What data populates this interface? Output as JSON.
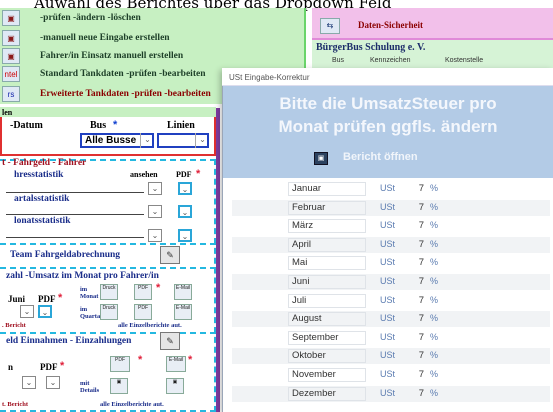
{
  "top_title": "Auwahl des Berichtes über das Dropdown Feld",
  "menu": {
    "items": [
      {
        "label": "-prüfen -ändern -löschen",
        "icon": "report-icon"
      },
      {
        "label": "-manuell neue Eingabe erstellen",
        "icon": "report-icon"
      },
      {
        "label": "Fahrer/in Einsatz manuell erstellen",
        "icon": "report-icon"
      },
      {
        "label": "Standard Tankdaten -prüfen -bearbeiten",
        "icon": "report-icon"
      },
      {
        "label": "Erweiterte Tankdaten -prüfen -bearbeiten",
        "icon": "report-icon"
      }
    ],
    "small_labels": [
      "ntel",
      "rs"
    ]
  },
  "header_right": {
    "security_label": "Daten-Sicherheit",
    "org_title": "BürgerBus Schulung e. V.",
    "columns": [
      "Bus",
      "Kennzeichen",
      "Kostenstelle"
    ]
  },
  "form": {
    "section_label": "len",
    "datum_label": "-Datum",
    "bus_label": "Bus",
    "star": "*",
    "linien_label": "Linien",
    "bus_value": "Alle Busse"
  },
  "stats": {
    "title": "t - Fahrgeld - Fahrer",
    "view_label": "ansehen",
    "pdf_label": "PDF",
    "rows": [
      "hresstatistik",
      "artalsstatistik",
      "lonatsstatistik"
    ],
    "team_label": "Team Fahrgeldabrechnung",
    "sum_title": "zahl -Umsatz im Monat pro Fahrer/in",
    "juni_label": "Juni",
    "im_monat": "im Monat",
    "im_quartal": "im Quartal",
    "druck": "Druck",
    "email": "E-Mail",
    "bericht": ". Bericht",
    "alle_einzel": "alle Einzelberichte aut.",
    "cash_title": "eld Einnahmen - Einzahlungen",
    "n_label": "n",
    "mit_details": "mit Details",
    "bericht2": "t. Bericht",
    "alle_einzel2": "alle Einzelberichte aut."
  },
  "dialog": {
    "window_title": "USt Eingabe-Korrektur",
    "heading_line1": "Bitte die UmsatzSteuer pro",
    "heading_line2": "Monat prüfen ggfls. ändern",
    "report_button": "Bericht öffnen",
    "ust_label": "USt",
    "pct_label": "%",
    "months": [
      {
        "name": "Januar",
        "value": "7"
      },
      {
        "name": "Februar",
        "value": "7"
      },
      {
        "name": "März",
        "value": "7"
      },
      {
        "name": "April",
        "value": "7"
      },
      {
        "name": "Mai",
        "value": "7"
      },
      {
        "name": "Juni",
        "value": "7"
      },
      {
        "name": "Juli",
        "value": "7"
      },
      {
        "name": "August",
        "value": "7"
      },
      {
        "name": "September",
        "value": "7"
      },
      {
        "name": "Oktober",
        "value": "7"
      },
      {
        "name": "November",
        "value": "7"
      },
      {
        "name": "Dezember",
        "value": "7"
      }
    ]
  },
  "colors": {
    "menu_bg": "#c7f0c2",
    "dialog_header_bg": "#b3cbe6",
    "accent_red": "#e0203a",
    "accent_blue": "#24b8e0"
  }
}
